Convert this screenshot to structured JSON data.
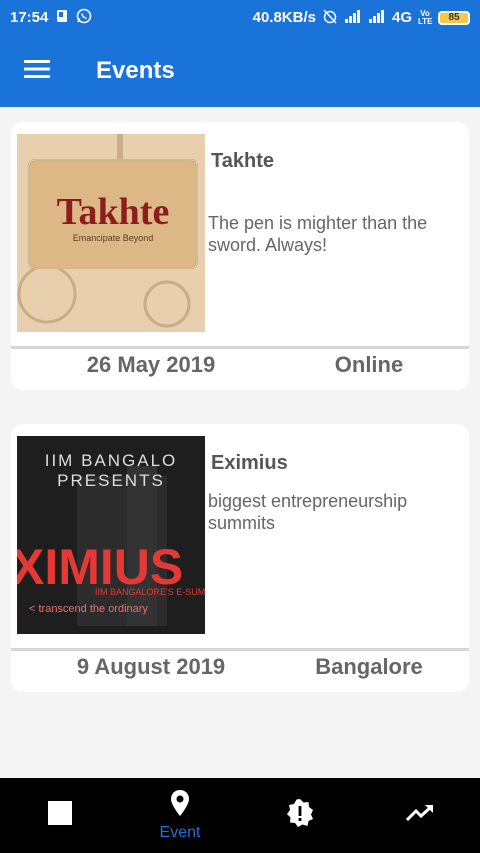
{
  "status_bar": {
    "time": "17:54",
    "network_speed": "40.8KB/s",
    "network_type": "4G",
    "volte": "Vo LTE",
    "battery": "85",
    "icons": [
      "sim-card-icon",
      "whatsapp-icon",
      "alarm-off-icon",
      "signal-icon",
      "signal-icon",
      "battery-icon"
    ]
  },
  "app_bar": {
    "title": "Events",
    "menu_icon": "hamburger-menu-icon"
  },
  "events": [
    {
      "title": "Takhte",
      "description": "The pen is mighter than the sword. Always!",
      "date": "26 May 2019",
      "location": "Online",
      "image_text": "Takhte",
      "image_subtext": "Emancipate Beyond"
    },
    {
      "title": "Eximius",
      "description": "biggest entrepreneurship summits",
      "date": "9 August 2019",
      "location": "Bangalore",
      "image_text": "XIMIUS",
      "image_header": "IIM BANGALO PRESENTS",
      "image_subtext": "IIM BANGALORE'S E-SUM",
      "image_tagline": "< transcend the ordinary"
    }
  ],
  "bottom_nav": {
    "items": [
      {
        "icon": "square-icon",
        "label": ""
      },
      {
        "icon": "location-pin-icon",
        "label": "Event"
      },
      {
        "icon": "alert-badge-icon",
        "label": ""
      },
      {
        "icon": "trending-up-icon",
        "label": ""
      }
    ],
    "active_index": 1
  },
  "colors": {
    "primary": "#1a73d9",
    "background": "#f4f4f4",
    "nav_background": "#000000"
  }
}
